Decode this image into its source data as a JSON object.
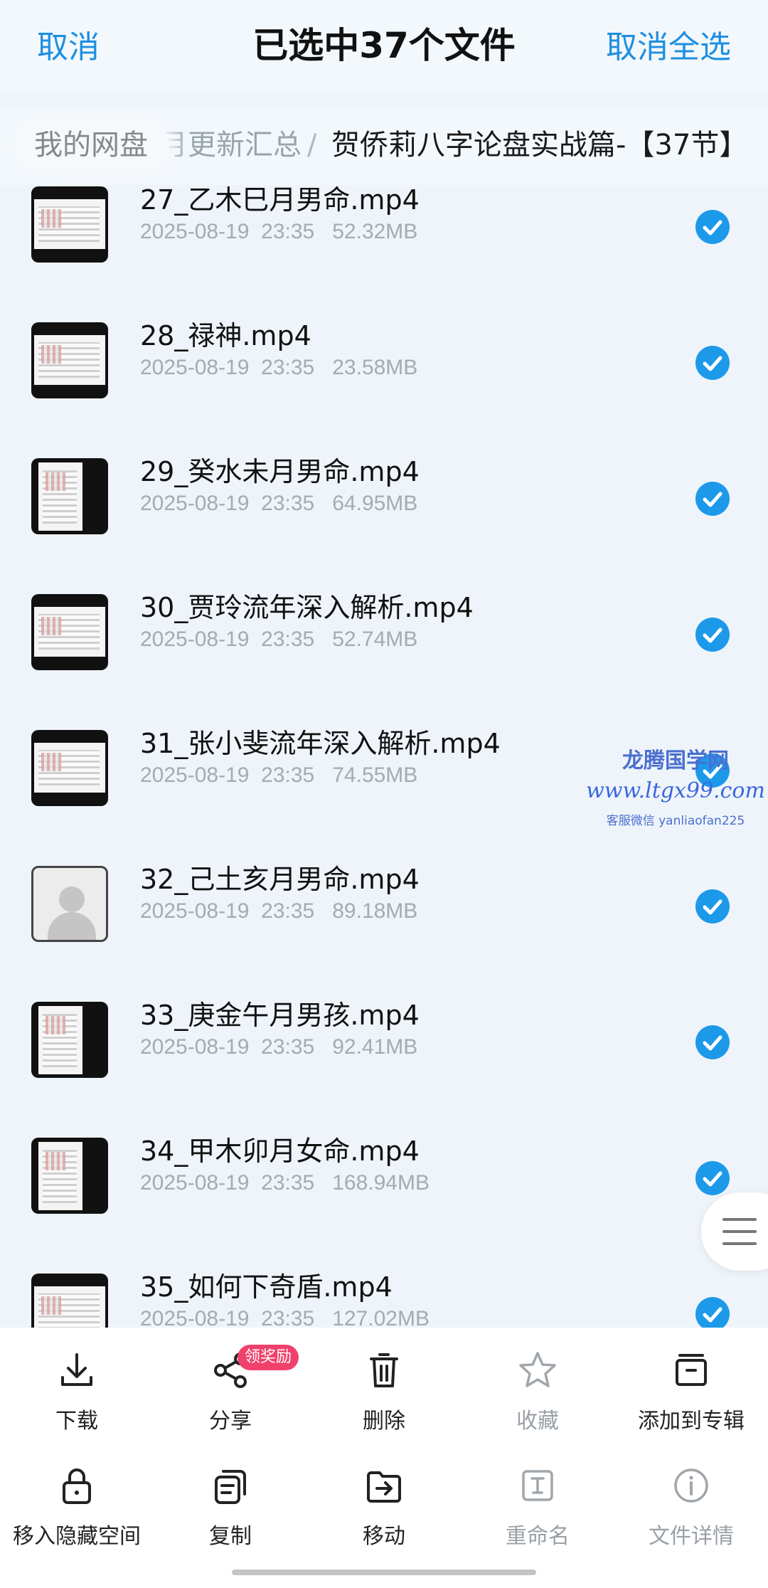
{
  "header": {
    "cancel_label": "取消",
    "title": "已选中37个文件",
    "deselect_all_label": "取消全选"
  },
  "breadcrumb": {
    "home": "我的网盘",
    "middle": "月更新汇总",
    "separator": "/",
    "current": "贺侨莉八字论盘实战篇-【37节】"
  },
  "files": [
    {
      "name": "27_乙木巳月男命.mp4",
      "date": "2025-08-19",
      "time": "23:35",
      "size": "52.32MB",
      "thumb": "landscape",
      "checked": true
    },
    {
      "name": "28_禄神.mp4",
      "date": "2025-08-19",
      "time": "23:35",
      "size": "23.58MB",
      "thumb": "landscape",
      "checked": true
    },
    {
      "name": "29_癸水未月男命.mp4",
      "date": "2025-08-19",
      "time": "23:35",
      "size": "64.95MB",
      "thumb": "portrait",
      "checked": true
    },
    {
      "name": "30_贾玲流年深入解析.mp4",
      "date": "2025-08-19",
      "time": "23:35",
      "size": "52.74MB",
      "thumb": "landscape",
      "checked": true
    },
    {
      "name": "31_张小斐流年深入解析.mp4",
      "date": "2025-08-19",
      "time": "23:35",
      "size": "74.55MB",
      "thumb": "landscape",
      "checked": true
    },
    {
      "name": "32_己土亥月男命.mp4",
      "date": "2025-08-19",
      "time": "23:35",
      "size": "89.18MB",
      "thumb": "avatar",
      "checked": true
    },
    {
      "name": "33_庚金午月男孩.mp4",
      "date": "2025-08-19",
      "time": "23:35",
      "size": "92.41MB",
      "thumb": "portrait",
      "checked": true
    },
    {
      "name": "34_甲木卯月女命.mp4",
      "date": "2025-08-19",
      "time": "23:35",
      "size": "168.94MB",
      "thumb": "portrait",
      "checked": true
    },
    {
      "name": "35_如何下奇盾.mp4",
      "date": "2025-08-19",
      "time": "23:35",
      "size": "127.02MB",
      "thumb": "landscape",
      "checked": true
    }
  ],
  "watermark": {
    "line1": "龙腾国学网",
    "line2": "www.ltgx99.com",
    "line3": "客服微信 yanliaofan225"
  },
  "toolbar": {
    "row1": [
      {
        "label": "下载",
        "icon": "download-icon",
        "enabled": true
      },
      {
        "label": "分享",
        "icon": "share-icon",
        "enabled": true
      },
      {
        "label": "删除",
        "icon": "trash-icon",
        "enabled": true
      },
      {
        "label": "收藏",
        "icon": "star-icon",
        "enabled": false
      },
      {
        "label": "添加到专辑",
        "icon": "album-icon",
        "enabled": true
      }
    ],
    "row2": [
      {
        "label": "移入隐藏空间",
        "icon": "lock-icon",
        "enabled": true
      },
      {
        "label": "复制",
        "icon": "copy-icon",
        "enabled": true
      },
      {
        "label": "移动",
        "icon": "move-icon",
        "enabled": true
      },
      {
        "label": "重命名",
        "icon": "rename-icon",
        "enabled": false
      },
      {
        "label": "文件详情",
        "icon": "info-icon",
        "enabled": false
      }
    ],
    "share_badge": "领奖励"
  },
  "colors": {
    "accent": "#1e8fe0",
    "check": "#1d99ea",
    "badge": "#f0406c",
    "background": "#eef4fa"
  }
}
